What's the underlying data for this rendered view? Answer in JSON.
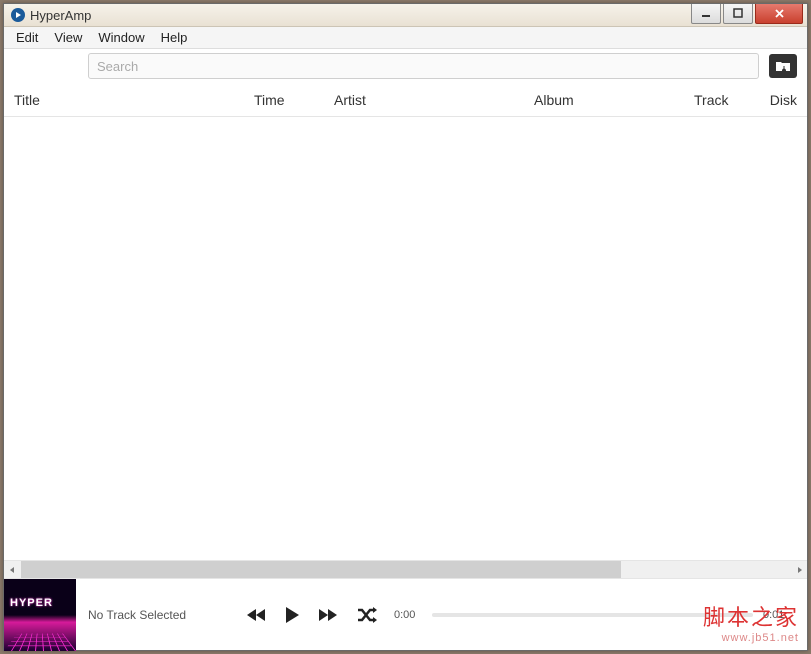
{
  "window": {
    "title": "HyperAmp"
  },
  "menubar": [
    "Edit",
    "View",
    "Window",
    "Help"
  ],
  "search": {
    "placeholder": "Search",
    "value": ""
  },
  "columns": {
    "title": "Title",
    "time": "Time",
    "artist": "Artist",
    "album": "Album",
    "track": "Track",
    "disk": "Disk"
  },
  "player": {
    "album_logo": "HYPER",
    "now_playing": "No Track Selected",
    "time_current": "0:00",
    "time_total": "0:01"
  },
  "watermark": {
    "text": "脚本之家",
    "url": "www.jb51.net"
  }
}
